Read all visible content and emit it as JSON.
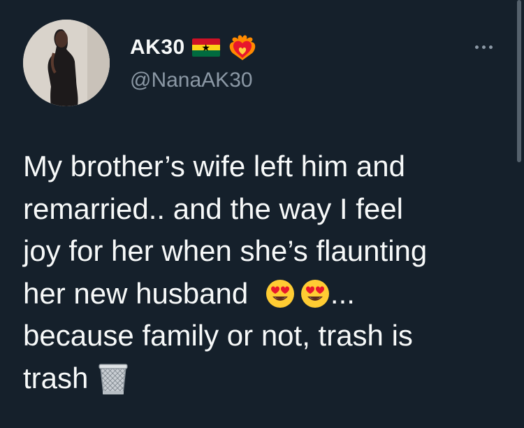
{
  "author": {
    "display_name": "AK30",
    "handle": "@NanaAK30",
    "badges": [
      "ghana-flag-icon",
      "heart-on-fire-icon"
    ]
  },
  "tweet": {
    "lines": [
      "My brother’s wife left him and",
      "remarried.. and the way I feel",
      "joy for her when she’s flaunting",
      "her new husband",
      "because family or not, trash is",
      "trash"
    ],
    "line4_suffix": "...",
    "emojis": [
      "heart-eyes-face-icon",
      "heart-eyes-face-icon",
      "wastebasket-icon"
    ]
  },
  "colors": {
    "background": "#15202b",
    "primary_text": "#f7f9f9",
    "secondary_text": "#8b98a5"
  }
}
